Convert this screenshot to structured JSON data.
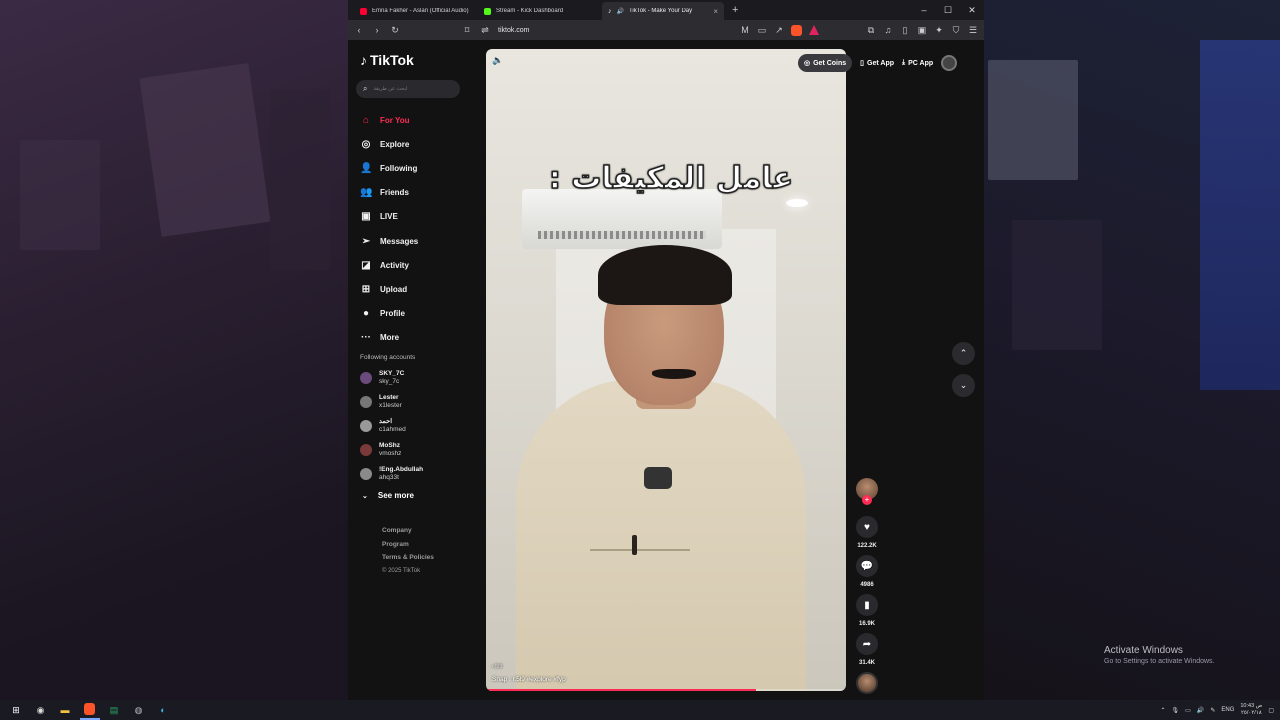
{
  "browser": {
    "tabs": [
      {
        "label": "Emna Fakher - Aslan (Official Audio)",
        "favicon_color": "#ff0033",
        "active": false
      },
      {
        "label": "Stream - Kick Dashboard",
        "favicon_color": "#53fc18",
        "active": false
      },
      {
        "label": "TikTok - Make Your Day",
        "favicon_color": "#ffffff",
        "active": true
      }
    ],
    "url": "tiktok.com"
  },
  "tiktok": {
    "logo": "TikTok",
    "search_placeholder": "ابحث عن طريقة",
    "nav": [
      {
        "label": "For You",
        "icon": "home-icon",
        "active": true
      },
      {
        "label": "Explore",
        "icon": "compass-icon"
      },
      {
        "label": "Following",
        "icon": "following-icon"
      },
      {
        "label": "Friends",
        "icon": "friends-icon"
      },
      {
        "label": "LIVE",
        "icon": "live-icon"
      },
      {
        "label": "Messages",
        "icon": "messages-icon"
      },
      {
        "label": "Activity",
        "icon": "activity-icon"
      },
      {
        "label": "Upload",
        "icon": "upload-icon"
      },
      {
        "label": "Profile",
        "icon": "profile-icon"
      },
      {
        "label": "More",
        "icon": "more-icon"
      }
    ],
    "following_title": "Following accounts",
    "accounts": [
      {
        "name": "SKY_7C",
        "handle": "sky_7c"
      },
      {
        "name": "Lester",
        "handle": "x1lester"
      },
      {
        "name": "احمد",
        "handle": "c1ahmed"
      },
      {
        "name": "MoShz",
        "handle": "vmoshz"
      },
      {
        "name": "!Eng.Abdullah",
        "handle": "ahq33t"
      }
    ],
    "see_more": "See more",
    "footer": [
      "Company",
      "Program",
      "Terms & Policies"
    ],
    "copyright": "© 2025 TikTok",
    "top_actions": {
      "coins": "Get Coins",
      "app": "Get App",
      "pc": "PC App"
    },
    "video": {
      "overlay_text": "عامل المكيفات :",
      "small_tag": "r.5l9",
      "caption": "Snap : r.5l9 #explore  #fyp",
      "progress": 0.75
    },
    "counts": {
      "likes": "122.2K",
      "comments": "4986",
      "saves": "16.9K",
      "shares": "31.4K"
    }
  },
  "desktop": {
    "activate_title": "Activate Windows",
    "activate_sub": "Go to Settings to activate Windows.",
    "lang": "ENG",
    "time": "10:43 ص",
    "date": "٢٥/٠٢/١٨"
  }
}
